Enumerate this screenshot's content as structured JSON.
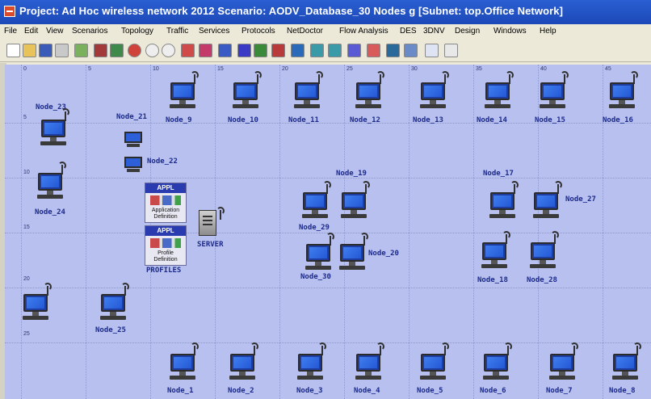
{
  "title": "Project: Ad Hoc wireless network 2012 Scenario: AODV_Database_30 Nodes g  [Subnet: top.Office Network]",
  "menu": [
    "File",
    "Edit",
    "View",
    "Scenarios",
    "Topology",
    "Traffic",
    "Services",
    "Protocols",
    "NetDoctor",
    "Flow Analysis",
    "DES",
    "3DNV",
    "Design",
    "Windows",
    "Help"
  ],
  "toolbar_icons": [
    "new-project-icon",
    "open-icon",
    "save-icon",
    "print-icon",
    "object-palette-icon",
    "link-icon",
    "failure-icon",
    "fail-recover-icon",
    "zoom-in-icon",
    "zoom-out-icon",
    "import-traffic-icon",
    "import-ace-icon",
    "vne-icon",
    "configure-run-des-icon",
    "view-results-icon",
    "hide-graphs-icon",
    "topology-icon",
    "link-view-icon",
    "node-view-icon",
    "wireless-icon",
    "dnv-icon",
    "flow-analysis-icon",
    "results-browser-icon",
    "edit-attributes-icon",
    "info-icon"
  ],
  "grid_ticks": [
    "0",
    "5",
    "10",
    "15",
    "20",
    "25",
    "30",
    "35",
    "40",
    "45"
  ],
  "row_ticks": [
    "5",
    "10",
    "15",
    "20",
    "25"
  ],
  "nodes": {
    "n1": "Node_1",
    "n2": "Node_2",
    "n3": "Node_3",
    "n4": "Node_4",
    "n5": "Node_5",
    "n6": "Node_6",
    "n7": "Node_7",
    "n8": "Node_8",
    "n9": "Node_9",
    "n10": "Node_10",
    "n11": "Node_11",
    "n12": "Node_12",
    "n13": "Node_13",
    "n14": "Node_14",
    "n15": "Node_15",
    "n16": "Node_16",
    "n17": "Node_17",
    "n18": "Node_18",
    "n19": "Node_19",
    "n20": "Node_20",
    "n21": "Node_21",
    "n22": "Node_22",
    "n23": "Node_23",
    "n24": "Node_24",
    "n25": "Node_25",
    "n27": "Node_27",
    "n28": "Node_28",
    "n29": "Node_29",
    "n30": "Node_30"
  },
  "server_label": "SERVER",
  "profiles_label": "PROFILES",
  "appl_header": "APPL",
  "app_def_caption": "Application Definition",
  "profile_def_caption": "Profile Definition"
}
